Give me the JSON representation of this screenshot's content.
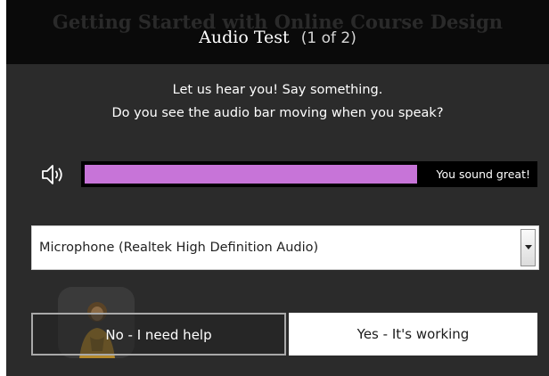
{
  "header": {
    "background_course_title": "Getting Started with Online Course Design",
    "title": "Audio Test",
    "step": "(1 of 2)"
  },
  "instructions": {
    "line1": "Let us hear you! Say something.",
    "line2": "Do you see the audio bar moving when you speak?"
  },
  "audio_meter": {
    "icon": "speaker-icon",
    "level_fraction": 0.74,
    "fill_color": "#c774d8",
    "status_text": "You sound great!"
  },
  "microphone_select": {
    "selected": "Microphone (Realtek High Definition Audio)"
  },
  "buttons": {
    "no_label": "No - I need help",
    "yes_label": "Yes - It's working"
  }
}
